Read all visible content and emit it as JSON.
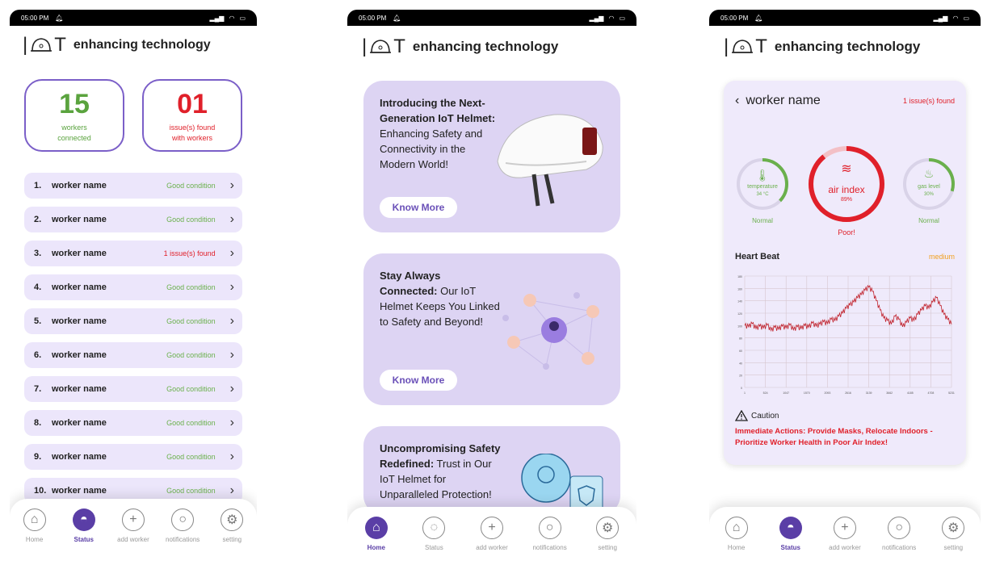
{
  "status_bar": {
    "time": "05:00 PM"
  },
  "brand": {
    "name": "enhancing technology"
  },
  "screen1": {
    "workers_connected": {
      "value": "15",
      "label_line1": "workers",
      "label_line2": "connected",
      "color": "#5aa33e"
    },
    "issues_found": {
      "value": "01",
      "label_line1": "issue(s) found",
      "label_line2": "with workers",
      "color": "#e0202a"
    },
    "workers": [
      {
        "idx": "1.",
        "name": "worker name",
        "status": "Good condition",
        "issue": false
      },
      {
        "idx": "2.",
        "name": "worker name",
        "status": "Good condition",
        "issue": false
      },
      {
        "idx": "3.",
        "name": "worker name",
        "status": "1 issue(s) found",
        "issue": true
      },
      {
        "idx": "4.",
        "name": "worker name",
        "status": "Good condition",
        "issue": false
      },
      {
        "idx": "5.",
        "name": "worker name",
        "status": "Good condition",
        "issue": false
      },
      {
        "idx": "6.",
        "name": "worker name",
        "status": "Good condition",
        "issue": false
      },
      {
        "idx": "7.",
        "name": "worker name",
        "status": "Good condition",
        "issue": false
      },
      {
        "idx": "8.",
        "name": "worker name",
        "status": "Good condition",
        "issue": false
      },
      {
        "idx": "9.",
        "name": "worker name",
        "status": "Good condition",
        "issue": false
      },
      {
        "idx": "10.",
        "name": "worker name",
        "status": "Good condition",
        "issue": false
      }
    ]
  },
  "nav": {
    "home": "Home",
    "status": "Status",
    "add_worker": "add worker",
    "notifications": "notifications",
    "setting": "setting"
  },
  "screen2": {
    "card1": {
      "bold": "Introducing the Next-Generation IoT Helmet:",
      "rest": " Enhancing Safety and Connectivity in the Modern World!",
      "button": "Know More"
    },
    "card2": {
      "bold": "Stay Always Connected:",
      "rest": " Our IoT Helmet Keeps You Linked to Safety and Beyond!",
      "button": "Know More"
    },
    "card3": {
      "bold": "Uncompromising Safety Redefined:",
      "rest": " Trust in Our IoT Helmet for Unparalleled Protection!"
    }
  },
  "screen3": {
    "worker_name": "worker name",
    "issues": "1 issue(s) found",
    "temperature": {
      "label": "temperature",
      "value": "34 °C",
      "status": "Normal"
    },
    "air_index": {
      "label": "air index",
      "value": "89%",
      "status": "Poor!"
    },
    "gas_level": {
      "label": "gas level",
      "value": "30%",
      "status": "Normal"
    },
    "heart_beat": {
      "title": "Heart Beat",
      "level": "medium"
    },
    "caution": {
      "title": "Caution",
      "message": "Immediate Actions: Provide Masks, Relocate Indoors - Prioritize Worker Health in Poor Air Index!"
    }
  },
  "chart_data": {
    "type": "line",
    "title": "Heart Beat",
    "ylim": [
      0,
      180
    ],
    "y_ticks": [
      "0",
      "20",
      "40",
      "60",
      "80",
      "100",
      "120",
      "140",
      "160",
      "180"
    ],
    "x_ticks": [
      "1",
      "524",
      "1047",
      "1570",
      "2093",
      "2616",
      "3139",
      "3662",
      "4185",
      "4708",
      "5231"
    ],
    "series": [
      {
        "values": [
          100,
          98,
          103,
          95,
          99,
          96,
          101,
          92,
          97,
          94,
          99,
          96,
          101,
          93,
          98,
          95,
          100,
          97,
          104,
          99,
          102,
          106,
          103,
          110,
          108,
          115,
          120,
          128,
          133,
          138,
          145,
          150,
          157,
          162,
          155,
          140,
          125,
          112,
          108,
          102,
          115,
          110,
          98,
          105,
          112,
          108,
          118,
          125,
          132,
          128,
          138,
          145,
          132,
          118,
          110,
          102
        ]
      }
    ]
  }
}
